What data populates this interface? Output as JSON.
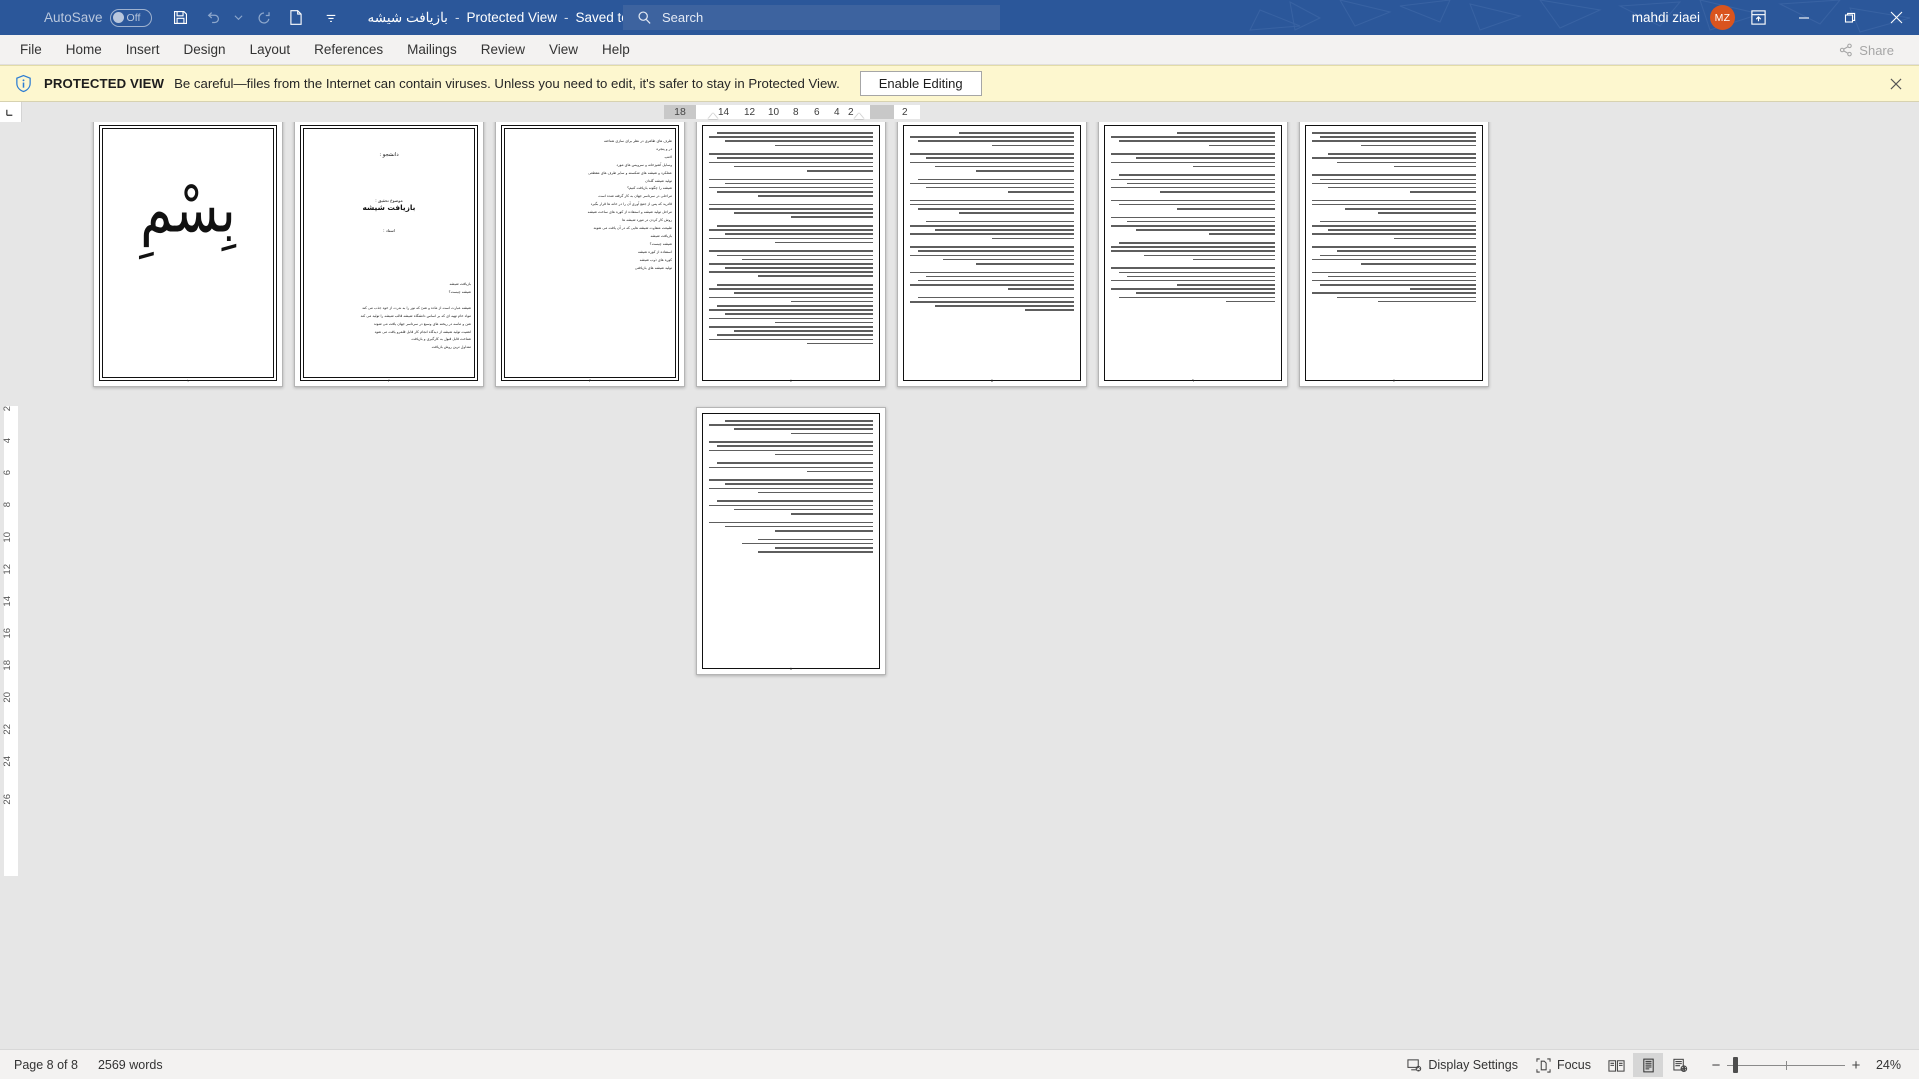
{
  "titlebar": {
    "autosave_label": "AutoSave",
    "autosave_state": "Off",
    "doc_name": "بازیافت شیشه",
    "separator": "-",
    "protected_view": "Protected View",
    "saved_location": "Saved to this PC",
    "user_name": "mahdi ziaei",
    "user_initials": "MZ",
    "icons": {
      "save": "save-icon",
      "undo": "undo-icon",
      "redo": "redo-icon",
      "new_doc": "new-document-icon",
      "customize": "customize-qat-caret-icon",
      "location_caret": "location-dropdown-caret",
      "ribbon_display": "ribbon-display-options-icon",
      "minimize": "minimize-icon",
      "restore": "restore-icon",
      "close": "close-icon"
    },
    "accent_color": "#2b579a",
    "avatar_color": "#d9541e"
  },
  "search": {
    "placeholder": "Search",
    "icon": "search-icon"
  },
  "ribbon": {
    "tabs": [
      {
        "label": "File"
      },
      {
        "label": "Home"
      },
      {
        "label": "Insert"
      },
      {
        "label": "Design"
      },
      {
        "label": "Layout"
      },
      {
        "label": "References"
      },
      {
        "label": "Mailings"
      },
      {
        "label": "Review"
      },
      {
        "label": "View"
      },
      {
        "label": "Help"
      }
    ],
    "share_label": "Share",
    "share_icon": "share-icon"
  },
  "protected_view": {
    "icon": "info-shield-icon",
    "title": "PROTECTED VIEW",
    "message": "Be careful—files from the Internet can contain viruses. Unless you need to edit, it's safer to stay in Protected View.",
    "button_label": "Enable Editing",
    "close_icon": "close-banner-icon",
    "background_color": "#fdf7cf"
  },
  "ruler": {
    "corner_icon": "tab-stop-selector-icon",
    "horizontal_ticks": [
      "18",
      "14",
      "12",
      "10",
      "8",
      "6",
      "4",
      "2",
      "2"
    ],
    "vertical_ticks": [
      "2",
      "4",
      "6",
      "8",
      "10",
      "12",
      "14",
      "16",
      "18",
      "20",
      "22",
      "24",
      "26"
    ]
  },
  "document": {
    "pages": [
      {
        "index": 1,
        "kind": "cover-bismillah",
        "page_number": "١"
      },
      {
        "index": 2,
        "kind": "title-page",
        "lines": [
          "دانشجو :",
          "موضوع تحقیق :",
          "بازیافت شیشه",
          "استاد :",
          "بازیافت شیشه",
          "شیشه چیست؟",
          "شیشه عبارت است از ماده و شئ که نور را به ندرت از خود جذب می کند",
          "مواد خام تهیه ای که بر اساس دانشگاه شیشه قالب شیشه را تولید می کند",
          "شن و ماسه در ریخته های وسیع در سرتاسر جهان یافت می شوند",
          "اهمیت تولید شیشه از دیدگاه انجام کار قابل قلمرو یافت می شود",
          "شناخت قابل قبول به کارگیری و بازیافت",
          "متداول ترین روش بازیافت"
        ],
        "page_number": "٢"
      },
      {
        "index": 3,
        "kind": "toc-page",
        "lines": [
          "ظرف های ظاهری در نظر برای سازی شناخته",
          "در و پنجره",
          "لامپ",
          "وسایل آشپزخانه و سرویس های مورد",
          "عملکرد و شیشه های شکسته و سایر ظرف های مقطعی",
          "تولید شیشه گلدان",
          "شیشه را چگونه بازیافت کنیم؟",
          "مراحلی در سرتاسر جهان به کار گرفته شده است",
          "قادرید که پس از جمع آوری آن را در خانه ها قرار بگیرد",
          "مراحل تولید شیشه و استفاده از کوره های ساخت شیشه",
          "روش کار کردن در مورد شیشه ها",
          "طبیعت متفاوت شیشه هایی که در آن یافت می شوند",
          "بازیافت شیشه",
          "شیشه چیست؟",
          "استفاده از کوره شیشه",
          "کوره های ذوب شیشه",
          "تولید شیشه های بازیافتی"
        ],
        "page_number": "٣"
      },
      {
        "index": 4,
        "kind": "body-dense",
        "page_number": "٤"
      },
      {
        "index": 5,
        "kind": "body-dense",
        "page_number": "٥"
      },
      {
        "index": 6,
        "kind": "body-dense",
        "page_number": "٦"
      },
      {
        "index": 7,
        "kind": "body-dense",
        "page_number": "٧"
      },
      {
        "index": 8,
        "kind": "body-last",
        "page_number": "٨"
      }
    ]
  },
  "statusbar": {
    "page_indicator": "Page 8 of 8",
    "word_count": "2569 words",
    "display_settings": "Display Settings",
    "display_settings_icon": "display-settings-icon",
    "focus_label": "Focus",
    "focus_icon": "focus-mode-icon",
    "view_read_icon": "read-mode-icon",
    "view_print_icon": "print-layout-icon",
    "view_web_icon": "web-layout-icon",
    "zoom_out_icon": "zoom-out-icon",
    "zoom_in_icon": "zoom-in-icon",
    "zoom_level": "24%"
  }
}
